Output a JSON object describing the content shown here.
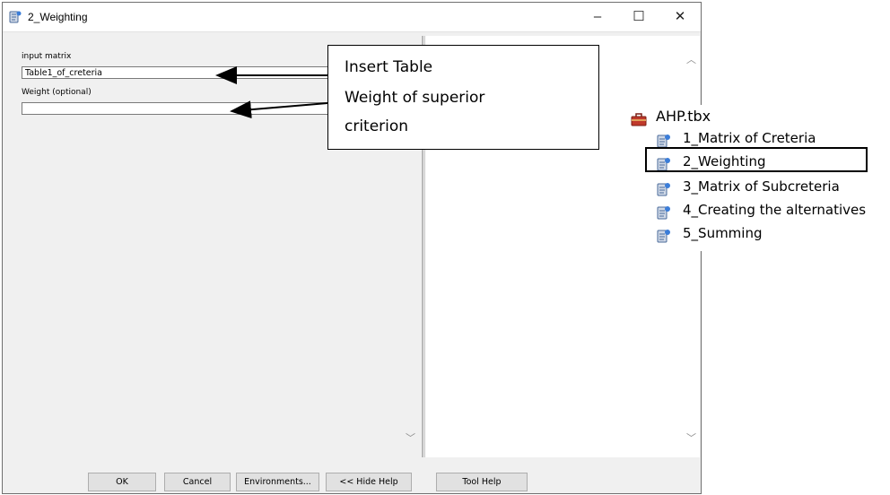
{
  "window": {
    "title": "2_Weighting",
    "controls": {
      "minimize": "–",
      "maximize": "☐",
      "close": "✕"
    }
  },
  "params": {
    "input_matrix_label": "input matrix",
    "input_matrix_value": "Table1_of_creteria",
    "weight_label": "Weight (optional)",
    "weight_value": ""
  },
  "buttons": {
    "ok": "OK",
    "cancel": "Cancel",
    "environments": "Environments...",
    "hide_help": "<< Hide Help",
    "tool_help": "Tool Help"
  },
  "annotation": {
    "line1": "Insert Table",
    "line2": "Weight of superior",
    "line3": "criterion"
  },
  "toolbox": {
    "name": "AHP.tbx",
    "items": [
      {
        "label": "1_Matrix of Creteria"
      },
      {
        "label": "2_Weighting"
      },
      {
        "label": "3_Matrix of Subcreteria"
      },
      {
        "label": "4_Creating the alternatives"
      },
      {
        "label": "5_Summing"
      }
    ],
    "highlighted_item": "2_Weighting"
  },
  "icons": {
    "script_tool": "script-tool-icon",
    "toolbox": "toolbox-icon"
  },
  "colors": {
    "dialog_bg": "#f0f0f0",
    "button_bg": "#e1e1e1",
    "toolbox_red": "#c0392b"
  }
}
